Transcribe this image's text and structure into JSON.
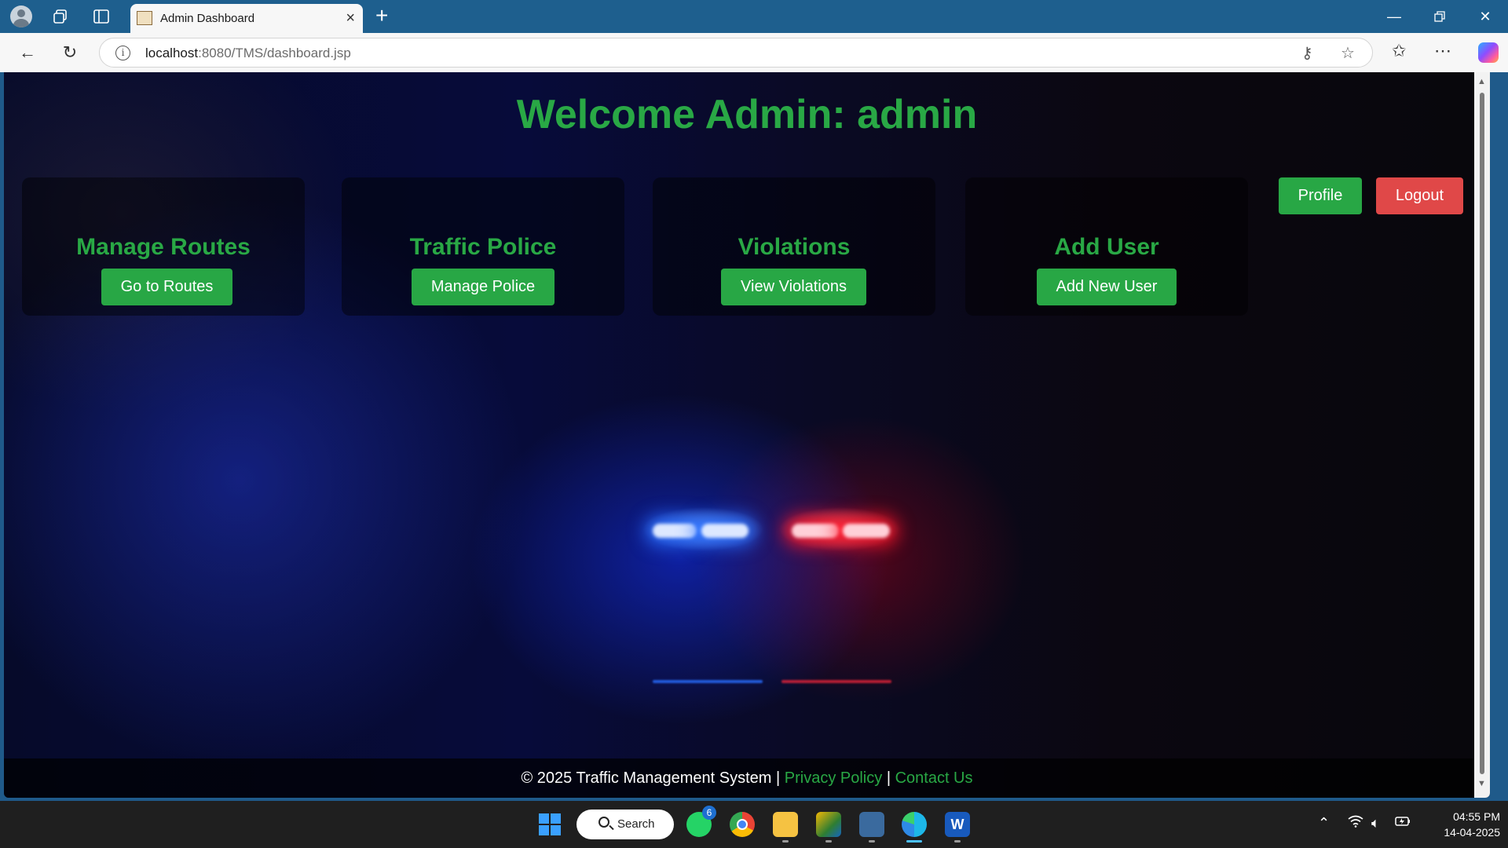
{
  "browser": {
    "tab_title": "Admin Dashboard",
    "url_host": "localhost",
    "url_path": ":8080/TMS/dashboard.jsp"
  },
  "page": {
    "welcome_heading": "Welcome Admin: admin",
    "profile_label": "Profile",
    "logout_label": "Logout",
    "cards": [
      {
        "title": "Manage Routes",
        "button": "Go to Routes"
      },
      {
        "title": "Traffic Police",
        "button": "Manage Police"
      },
      {
        "title": "Violations",
        "button": "View Violations"
      },
      {
        "title": "Add User",
        "button": "Add New User"
      }
    ],
    "footer": {
      "copyright": "© 2025 Traffic Management System |",
      "privacy": "Privacy Policy",
      "separator": "|",
      "contact": "Contact Us"
    },
    "colors": {
      "accent_green": "#28a745",
      "logout_red": "#e04848"
    }
  },
  "taskbar": {
    "search_label": "Search",
    "whatsapp_badge": "6",
    "time": "04:55 PM",
    "date": "14-04-2025"
  }
}
